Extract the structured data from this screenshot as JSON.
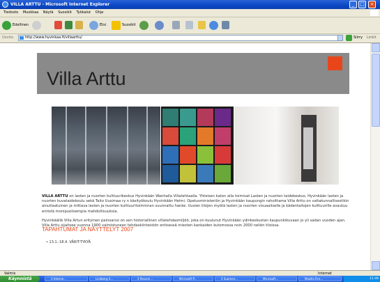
{
  "window": {
    "title": "VILLA ARTTU - Microsoft Internet Explorer"
  },
  "menu": [
    "Tiedosto",
    "Muokkaa",
    "Näytä",
    "Suosikit",
    "Työkalut",
    "Ohje"
  ],
  "toolbar": {
    "back": "Edellinen",
    "search": "Etsi",
    "favorites": "Suosikit"
  },
  "address": {
    "label": "Osoite",
    "url": "http://www.hyvinkaa.fi/villaarttu/",
    "go": "Siirry",
    "links": "Linkit"
  },
  "page": {
    "site_title": "Villa Arttu",
    "brand_color": "#e8461a",
    "intro_bold": "VILLA ARTTU",
    "intro_text": " on lasten ja nuorten kulttuurikeskus Hyvinkään Wanhalla Villatehtaalla. Yhteisen katon alla toimivat Lasten ja nuorten taidekeskus, Hyvinkään lasten ja nuorten kuvataidekoulu sekä Taito Uusimaa ry n käsityökoulu Hyvinkään Helmi. Opetusministeriön ja Hyvinkään kaupungin rahoittama Villa Arttu on valtakunnallisestikin ainutlaatuinen ja mittava lasten ja nuorten kulttuuritoiminnan suunnattu hanke. Uusien tilojen myötä lasten ja nuorten visuaaliselle ja käden­taitojen kulttuurille avautuu entistä monipuolisempia mahdollisuuksia.",
    "history_text": "Hyvinkäällä Villa Artun erityinen painoarvo on sen historiallinen villatehdasmiljöö, joka on kuulunut Hyvinkään ydinkeskustan kaupunkikuvaan jo yli sadan vuoden ajan. Villa Arttu sijaitsee vuonna 1900 valmistuneen tehdaskiinteistön entisessä miesten kankaiden kutomossa noin 2000 neliön tiloissa.",
    "section_title": "TAPAHTUMAT JA NÄYTTELYT 2007",
    "event_item": "13.1.-18.4. VÄRIT-TYKYÄ"
  },
  "status": {
    "left": "Valmis",
    "right": "Internet"
  },
  "taskbar": {
    "start": "Käynnistä",
    "buttons": [
      "2 Interne...",
      "Lindberg S...",
      "2 Resursi...",
      "Microsoft P...",
      "2 Suomen...",
      "Microsoft...",
      "Mozilla Fire..."
    ],
    "clock": "11:49"
  }
}
